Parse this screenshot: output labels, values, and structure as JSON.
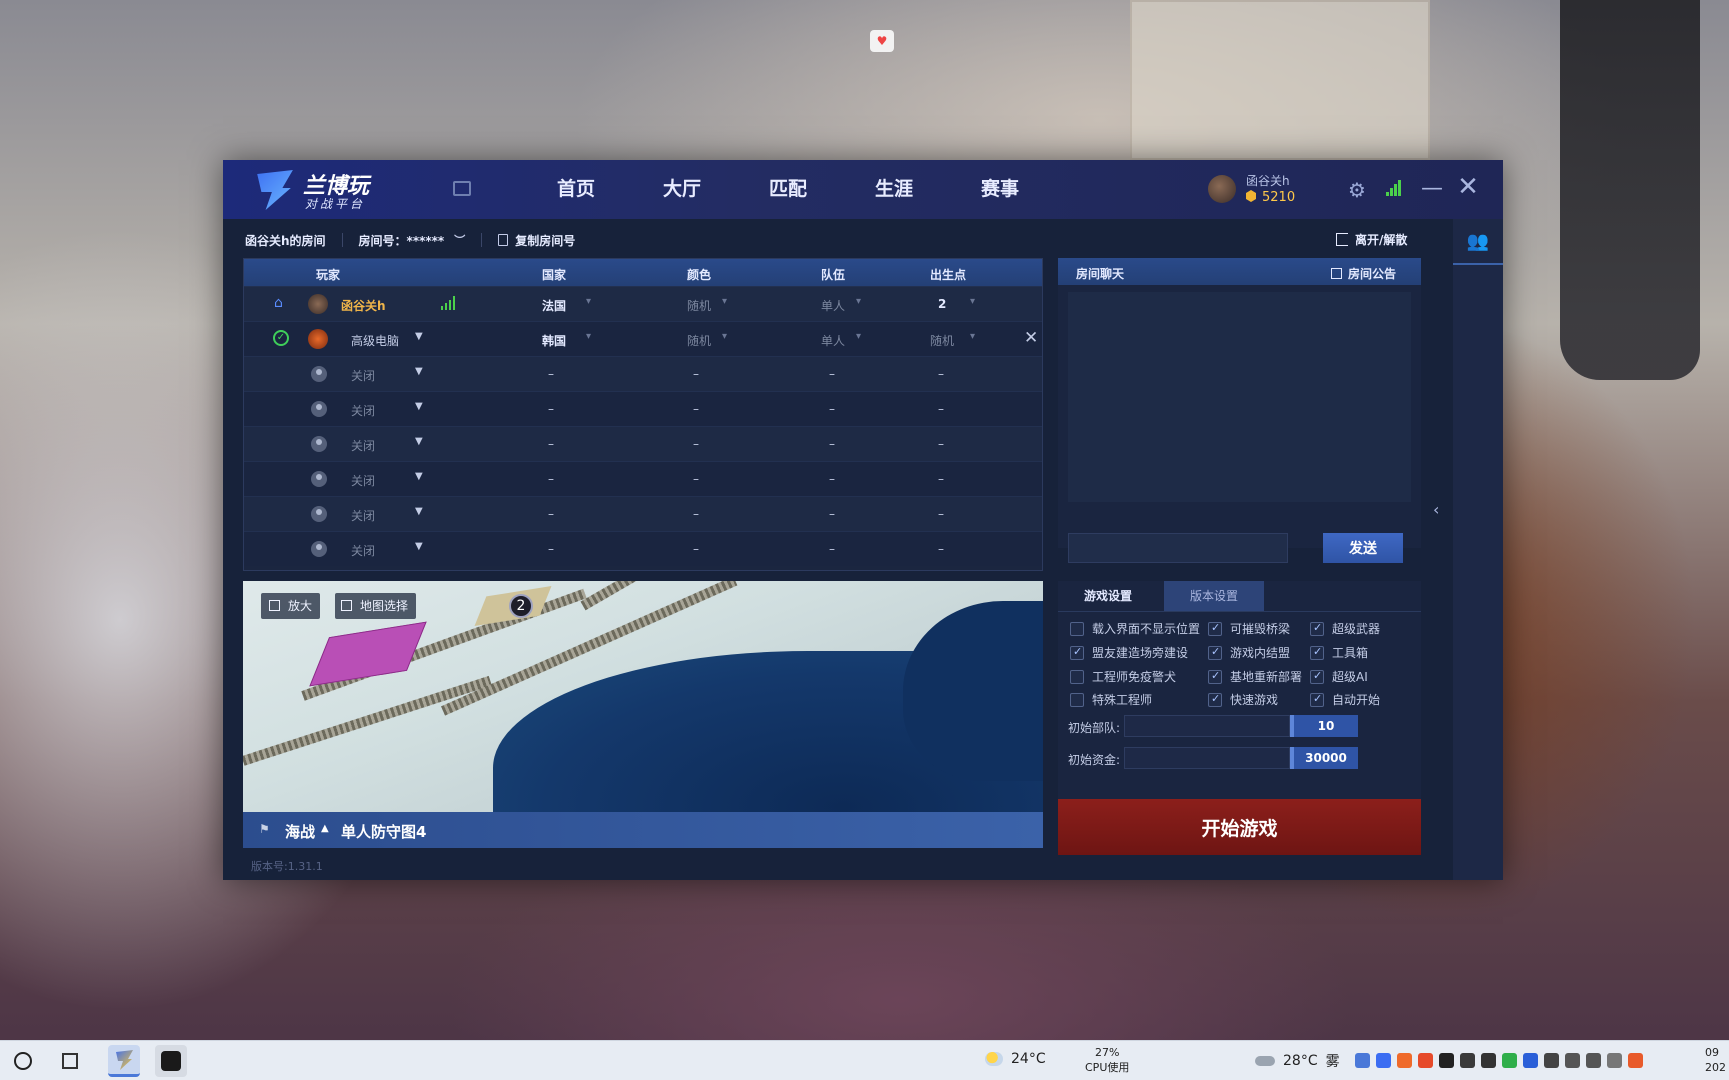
{
  "app": {
    "logo_name": "兰博玩",
    "logo_sub": "对战平台",
    "nav": [
      "首页",
      "大厅",
      "匹配",
      "生涯",
      "赛事"
    ],
    "user": {
      "name": "函谷关h",
      "coins": "5210"
    }
  },
  "room": {
    "name": "函谷关h的房间",
    "number_label": "房间号：******",
    "copy_label": "复制房间号",
    "leave_label": "离开/解散"
  },
  "table": {
    "headers": {
      "player": "玩家",
      "country": "国家",
      "color": "颜色",
      "team": "队伍",
      "spawn": "出生点"
    },
    "rows": [
      {
        "player": "函谷关h",
        "country": "法国",
        "color": "随机",
        "team": "单人",
        "spawn": "2"
      },
      {
        "player": "高级电脑",
        "country": "韩国",
        "color": "随机",
        "team": "单人",
        "spawn": "随机"
      },
      {
        "player": "关闭",
        "country": "–",
        "color": "–",
        "team": "–",
        "spawn": "–"
      },
      {
        "player": "关闭",
        "country": "–",
        "color": "–",
        "team": "–",
        "spawn": "–"
      },
      {
        "player": "关闭",
        "country": "–",
        "color": "–",
        "team": "–",
        "spawn": "–"
      },
      {
        "player": "关闭",
        "country": "–",
        "color": "–",
        "team": "–",
        "spawn": "–"
      },
      {
        "player": "关闭",
        "country": "–",
        "color": "–",
        "team": "–",
        "spawn": "–"
      },
      {
        "player": "关闭",
        "country": "–",
        "color": "–",
        "team": "–",
        "spawn": "–"
      }
    ]
  },
  "map": {
    "zoom_label": "放大",
    "select_label": "地图选择",
    "spawn_marker": "2",
    "mode": "海战",
    "name": "单人防守图4"
  },
  "version": "版本号:1.31.1",
  "chat": {
    "title": "房间聊天",
    "notice_label": "房间公告",
    "send_label": "发送",
    "input_value": ""
  },
  "settings": {
    "tabs": [
      "游戏设置",
      "版本设置"
    ],
    "options": [
      {
        "label": "载入界面不显示位置",
        "checked": false
      },
      {
        "label": "可摧毁桥梁",
        "checked": true
      },
      {
        "label": "超级武器",
        "checked": true
      },
      {
        "label": "盟友建造场旁建设",
        "checked": true
      },
      {
        "label": "游戏内结盟",
        "checked": true
      },
      {
        "label": "工具箱",
        "checked": true
      },
      {
        "label": "工程师免疫警犬",
        "checked": false
      },
      {
        "label": "基地重新部署",
        "checked": true
      },
      {
        "label": "超级AI",
        "checked": true
      },
      {
        "label": "特殊工程师",
        "checked": false
      },
      {
        "label": "快速游戏",
        "checked": true
      },
      {
        "label": "自动开始",
        "checked": true
      }
    ],
    "units_label": "初始部队:",
    "units_value": "10",
    "funds_label": "初始资金:",
    "funds_value": "30000"
  },
  "start_label": "开始游戏",
  "taskbar": {
    "temp1": "24°C",
    "cpu_pct": "27%",
    "cpu_label": "CPU使用",
    "temp2": "28°C",
    "weather2": "雾",
    "clock": "09\n202"
  }
}
